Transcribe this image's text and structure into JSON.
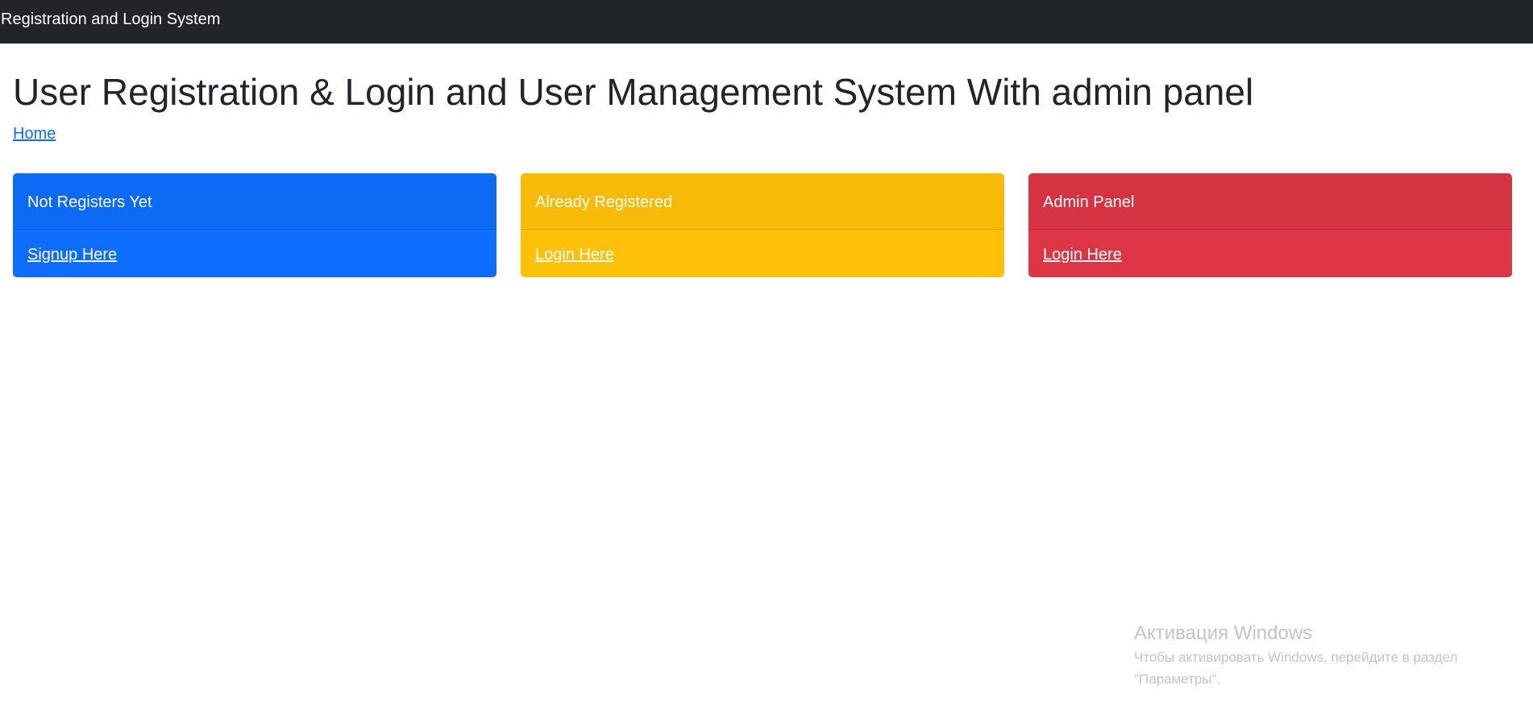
{
  "navbar": {
    "brand": "Registration and Login System"
  },
  "main": {
    "title": "User Registration & Login and User Management System With admin panel",
    "breadcrumb": "Home"
  },
  "cards": [
    {
      "header": "Not Registers Yet",
      "link": "Signup Here",
      "color": "#0d6efd"
    },
    {
      "header": "Already Registered",
      "link": "Login Here",
      "color": "#ffc107"
    },
    {
      "header": "Admin Panel",
      "link": "Login Here",
      "color": "#dc3545"
    }
  ],
  "watermark": {
    "title": "Активация Windows",
    "line1": "Чтобы активировать Windows, перейдите в раздел",
    "line2": "\"Параметры\"."
  }
}
